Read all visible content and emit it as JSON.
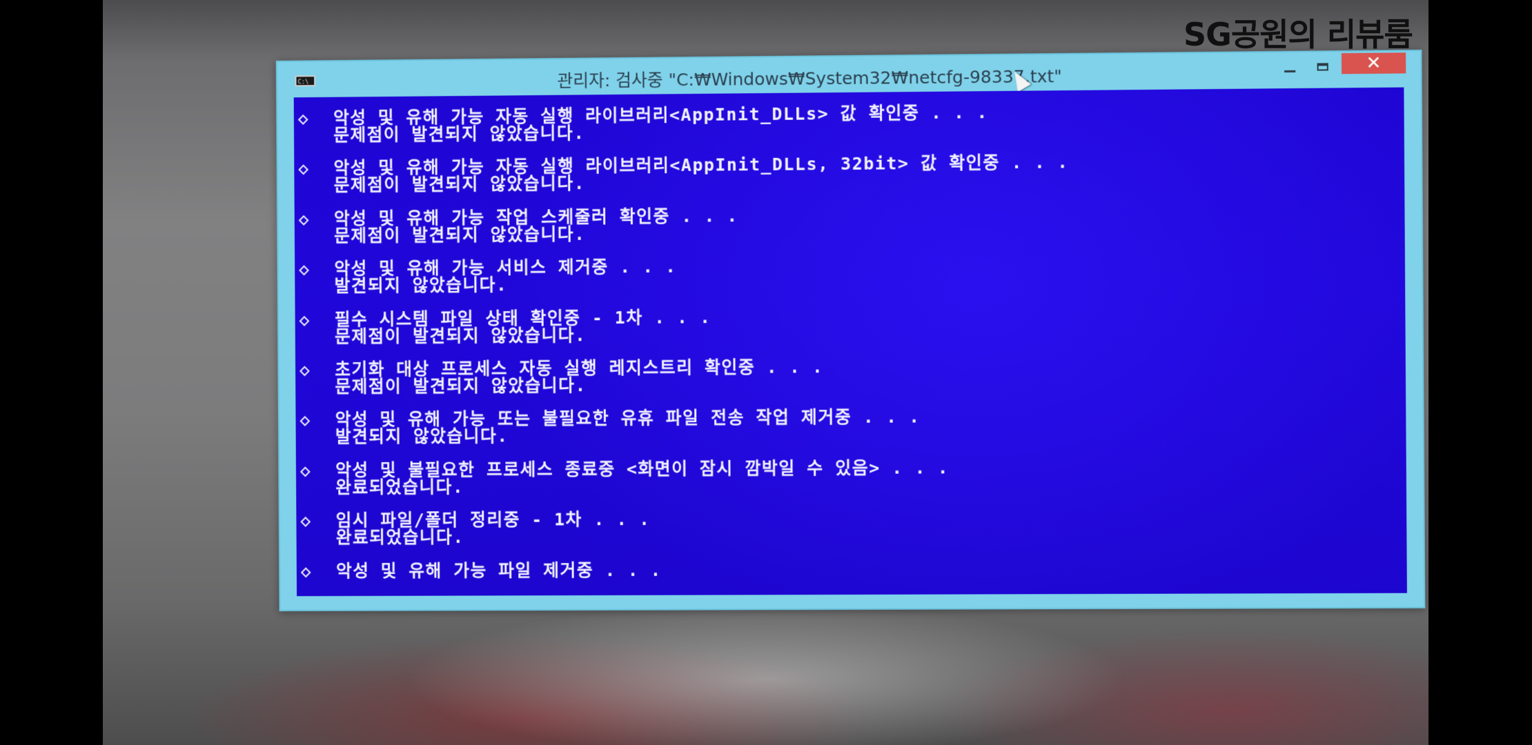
{
  "watermark": "SG공원의 리뷰룸",
  "window": {
    "title": "관리자:  검사중  \"C:₩Windows₩System32₩netcfg-98337.txt\"",
    "icon_label": "C:\\",
    "close_glyph": "✕"
  },
  "console": {
    "bullet": "◇",
    "lines": [
      {
        "l1": "악성 및 유해 가능 자동 실행 라이브러리<AppInit_DLLs> 값 확인중 . . .",
        "l2": "문제점이 발견되지 않았습니다."
      },
      {
        "l1": "악성 및 유해 가능 자동 실행 라이브러리<AppInit_DLLs, 32bit> 값 확인중 . . .",
        "l2": "문제점이 발견되지 않았습니다."
      },
      {
        "l1": "악성 및 유해 가능 작업 스케줄러 확인중 . . .",
        "l2": "문제점이 발견되지 않았습니다."
      },
      {
        "l1": "악성 및 유해 가능 서비스 제거중 . . .",
        "l2": "발견되지 않았습니다."
      },
      {
        "l1": "필수 시스템 파일 상태 확인중 - 1차 . . .",
        "l2": "문제점이 발견되지 않았습니다."
      },
      {
        "l1": "초기화 대상 프로세스 자동 실행 레지스트리 확인중 . . .",
        "l2": "문제점이 발견되지 않았습니다."
      },
      {
        "l1": "악성 및 유해 가능 또는 불필요한 유휴 파일 전송 작업 제거중 . . .",
        "l2": "발견되지 않았습니다."
      },
      {
        "l1": "악성 및 불필요한 프로세스 종료중 <화면이 잠시 깜박일 수 있음> . . .",
        "l2": "완료되었습니다."
      },
      {
        "l1": "임시 파일/폴더 정리중 - 1차 . . .",
        "l2": "완료되었습니다."
      },
      {
        "l1": "악성 및 유해 가능 파일 제거중 . . .",
        "l2": ""
      }
    ]
  },
  "icons": {
    "app": "console-icon",
    "cursor": "mouse-cursor-icon",
    "minimize": "minimize-icon",
    "maximize": "maximize-icon",
    "close": "close-icon"
  }
}
